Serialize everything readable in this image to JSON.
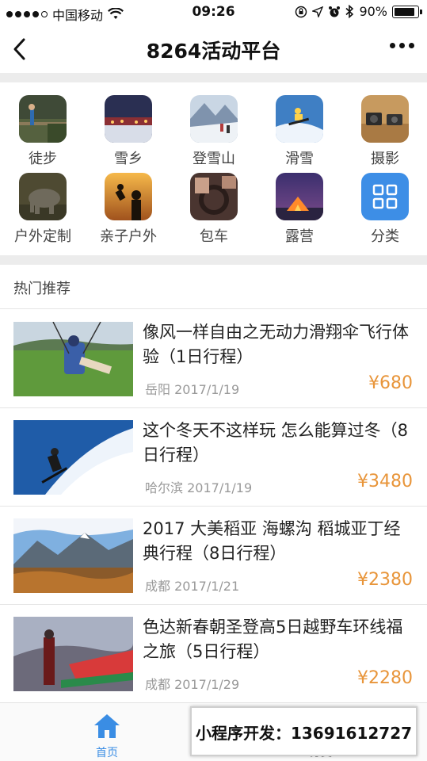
{
  "status_bar": {
    "carrier": "中国移动",
    "time": "09:26",
    "battery": "90%",
    "battery_level": 0.9
  },
  "navbar": {
    "title": "8264活动平台"
  },
  "categories": [
    {
      "label": "徒步",
      "icon": "hiking-photo"
    },
    {
      "label": "雪乡",
      "icon": "snow-village-photo"
    },
    {
      "label": "登雪山",
      "icon": "snow-mountain-photo"
    },
    {
      "label": "滑雪",
      "icon": "ski-photo"
    },
    {
      "label": "摄影",
      "icon": "camera-photo"
    },
    {
      "label": "户外定制",
      "icon": "elephant-photo"
    },
    {
      "label": "亲子户外",
      "icon": "family-photo"
    },
    {
      "label": "包车",
      "icon": "driving-photo"
    },
    {
      "label": "露营",
      "icon": "tent-photo"
    },
    {
      "label": "分类",
      "icon": "grid-icon",
      "color": "#3d8ee6"
    }
  ],
  "hot": {
    "heading": "热门推荐",
    "items": [
      {
        "title": "像风一样自由之无动力滑翔伞飞行体验（1日行程）",
        "city": "岳阳",
        "date": "2017/1/19",
        "price": "¥680"
      },
      {
        "title": "这个冬天不这样玩 怎么能算过冬（8日行程）",
        "city": "哈尔滨",
        "date": "2017/1/19",
        "price": "¥3480"
      },
      {
        "title": "2017 大美稻亚 海螺沟 稻城亚丁经典行程（8日行程）",
        "city": "成都",
        "date": "2017/1/21",
        "price": "¥2380"
      },
      {
        "title": "色达新春朝圣登高5日越野车环线福之旅（5日行程）",
        "city": "成都",
        "date": "2017/1/29",
        "price": "¥2280"
      }
    ]
  },
  "tabbar": {
    "home": "首页",
    "category": "分类",
    "accent": "#3a8de4"
  },
  "promo": {
    "text": "小程序开发：13691612727"
  },
  "colors": {
    "price": "#e8953a"
  }
}
